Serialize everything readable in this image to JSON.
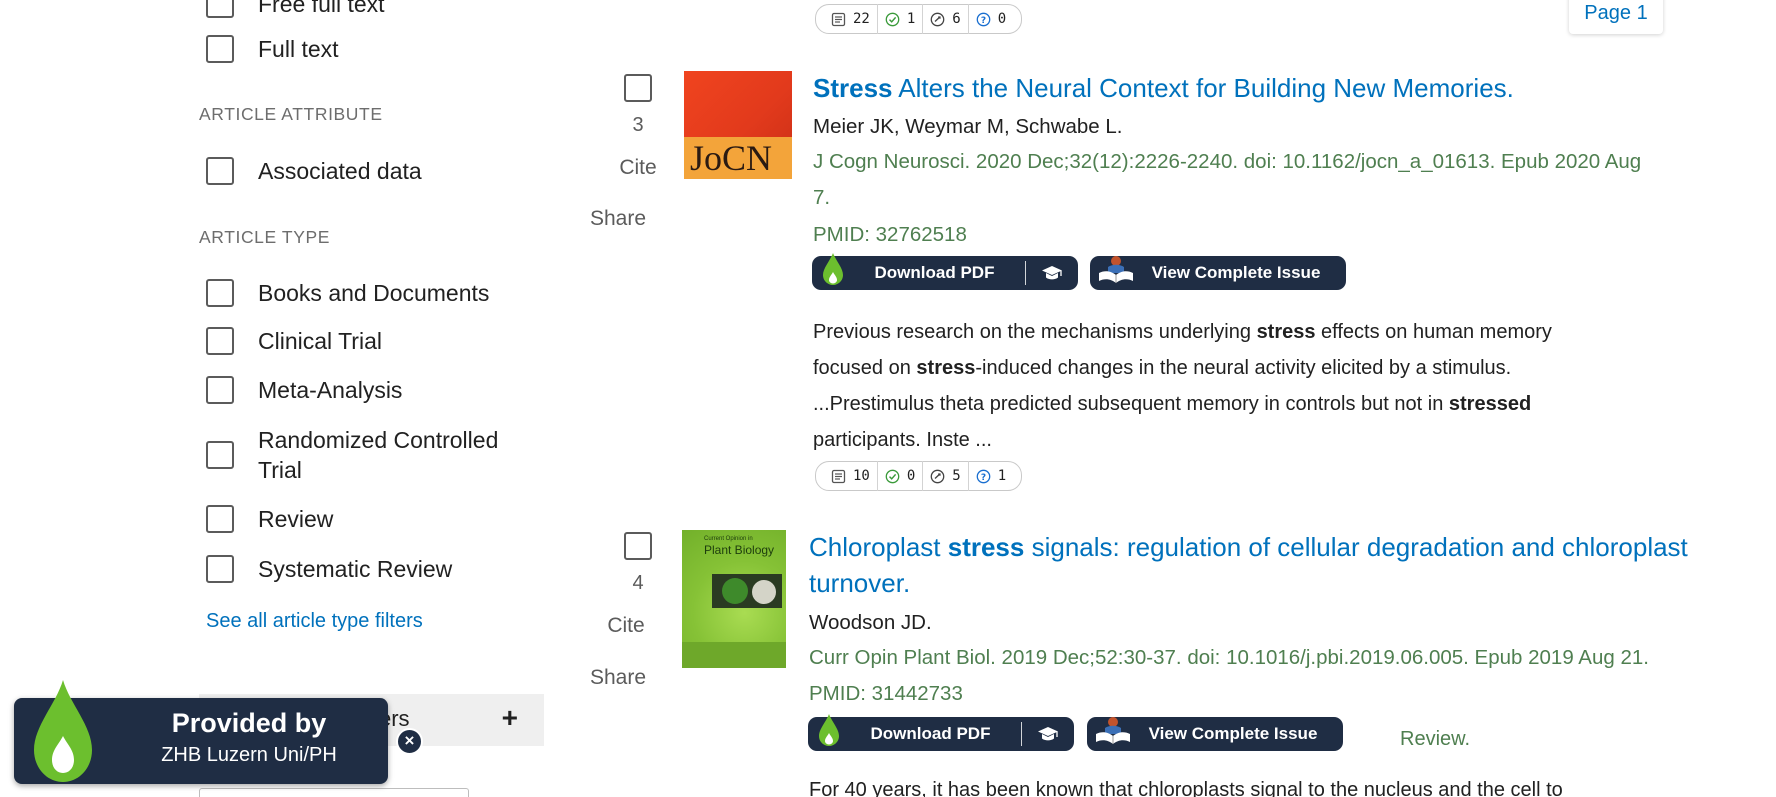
{
  "sidebar": {
    "text_availability": [
      {
        "label": "Free full text"
      },
      {
        "label": "Full text"
      }
    ],
    "article_attribute_heading": "ARTICLE ATTRIBUTE",
    "article_attribute": [
      {
        "label": "Associated data"
      }
    ],
    "article_type_heading": "ARTICLE TYPE",
    "article_type": [
      {
        "label": "Books and Documents"
      },
      {
        "label": "Clinical Trial"
      },
      {
        "label": "Meta-Analysis"
      },
      {
        "label": "Randomized Controlled Trial"
      },
      {
        "label": "Review"
      },
      {
        "label": "Systematic Review"
      }
    ],
    "see_all_link": "See all article type filters",
    "more_filters": {
      "label_fragment": "ers",
      "plus": "+"
    }
  },
  "provided_by": {
    "line1": "Provided by",
    "line2": "ZHB Luzern Uni/PH",
    "close": "×"
  },
  "pagination": {
    "page_label": "Page 1"
  },
  "results": [
    {
      "stats": {
        "comments": "22",
        "supported": "1",
        "disputed": "6",
        "questions": "0"
      }
    },
    {
      "number": "3",
      "cite": "Cite",
      "share": "Share",
      "thumb_text": "JoCN",
      "title_bold": "Stress",
      "title_rest": " Alters the Neural Context for Building New Memories.",
      "authors": "Meier JK, Weymar M, Schwabe L.",
      "citation": "J Cogn Neurosci. 2020 Dec;32(12):2226-2240. doi: 10.1162/jocn_a_01613. Epub 2020 Aug 7.",
      "pmid": "PMID: 32762518",
      "download_pdf": "Download PDF",
      "view_issue": "View Complete Issue",
      "abstract": [
        {
          "t": "Previous research on the mechanisms underlying ",
          "b": false
        },
        {
          "t": "stress",
          "b": true
        },
        {
          "t": " effects on human memory focused on ",
          "b": false
        },
        {
          "t": "stress",
          "b": true
        },
        {
          "t": "-induced changes in the neural activity elicited by a stimulus. ...Prestimulus theta predicted subsequent memory in controls but not in ",
          "b": false
        },
        {
          "t": "stressed",
          "b": true
        },
        {
          "t": " participants. Inste ...",
          "b": false
        }
      ],
      "stats": {
        "comments": "10",
        "supported": "0",
        "disputed": "5",
        "questions": "1"
      }
    },
    {
      "number": "4",
      "cite": "Cite",
      "share": "Share",
      "thumb_text": {
        "journal_top": "Current Opinion in",
        "journal_name": "Plant Biology"
      },
      "title_pre": "Chloroplast ",
      "title_bold": "stress",
      "title_rest": " signals: regulation of cellular degradation and chloroplast turnover.",
      "authors": "Woodson JD.",
      "citation": "Curr Opin Plant Biol. 2019 Dec;52:30-37. doi: 10.1016/j.pbi.2019.06.005. Epub 2019 Aug 21.",
      "pmid": "PMID: 31442733",
      "download_pdf": "Download PDF",
      "view_issue": "View Complete Issue",
      "pub_type": "Review.",
      "abstract_start": "For 40 years, it has been known that chloroplasts signal to the nucleus and the cell to"
    }
  ],
  "colors": {
    "link": "#0071bc",
    "citation_green": "#4f7f50",
    "navy_button": "#1f2d44",
    "drop_green": "#6cbf2e"
  },
  "icons": {
    "comments": "comment-lines-icon",
    "supported": "check-circle-icon",
    "disputed": "slash-circle-icon",
    "questions": "question-circle-icon",
    "drop": "green-drop-icon",
    "cap": "graduation-cap-icon",
    "book": "open-book-reader-icon"
  }
}
